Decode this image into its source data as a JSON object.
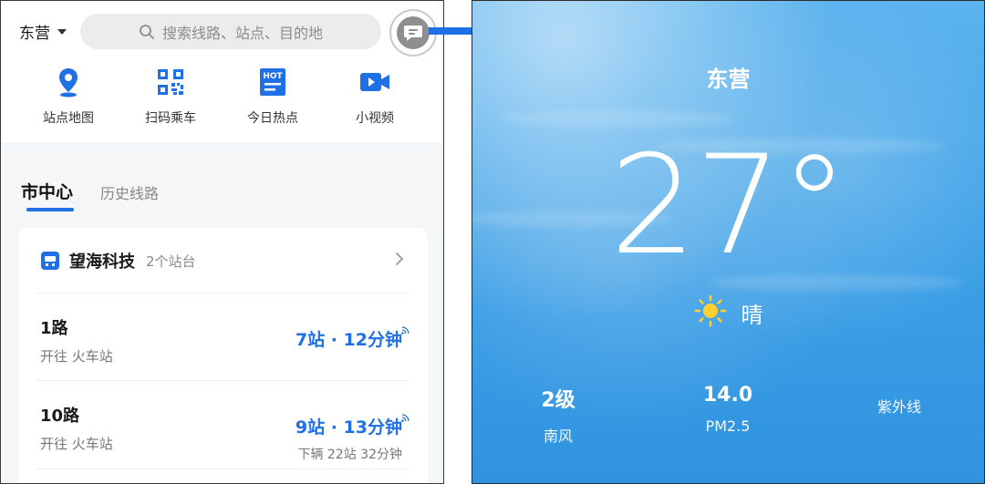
{
  "app": {
    "city": "东营",
    "search_placeholder": "搜索线路、站点、目的地",
    "quick_actions": [
      {
        "label": "站点地图",
        "icon": "location-pin-icon"
      },
      {
        "label": "扫码乘车",
        "icon": "qr-code-icon"
      },
      {
        "label": "今日热点",
        "icon": "hot-news-icon"
      },
      {
        "label": "小视频",
        "icon": "video-camera-icon"
      }
    ],
    "tabs": [
      {
        "label": "市中心",
        "active": true
      },
      {
        "label": "历史线路",
        "active": false
      }
    ],
    "station": {
      "name": "望海科技",
      "count": "2个站台"
    },
    "routes": [
      {
        "name": "1路",
        "direction": "开往 火车站",
        "eta": "7站 · 12分钟",
        "sub": ""
      },
      {
        "name": "10路",
        "direction": "开往 火车站",
        "eta": "9站 · 13分钟",
        "sub": "下辆 22站 32分钟"
      }
    ],
    "accent": "#1f6fe5"
  },
  "weather": {
    "city": "东营",
    "temperature": "27°",
    "condition": "晴",
    "condition_icon": "sun-icon",
    "stats": [
      {
        "value": "2级",
        "label": "南风"
      },
      {
        "value": "14.0",
        "label": "PM2.5"
      },
      {
        "value": "",
        "label": "紫外线"
      }
    ]
  }
}
